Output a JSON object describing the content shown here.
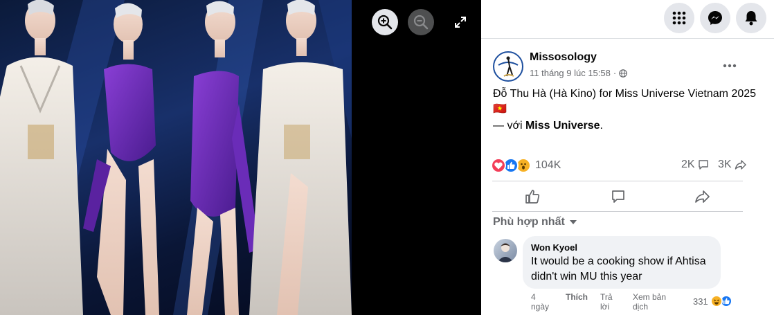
{
  "viewer": {
    "controls": [
      {
        "name": "zoom-in",
        "icon": "zoom-in-icon"
      },
      {
        "name": "zoom-out",
        "icon": "zoom-out-icon"
      },
      {
        "name": "fullscreen",
        "icon": "expand-icon"
      }
    ]
  },
  "topbar": {
    "buttons": [
      {
        "icon": "apps-grid-icon"
      },
      {
        "icon": "messenger-icon"
      },
      {
        "icon": "notifications-bell-icon"
      }
    ]
  },
  "post": {
    "author": "Missosology",
    "timestamp": "11 tháng 9 lúc 15:58",
    "separator": "·",
    "privacy_icon": "globe-icon",
    "text": "Đỗ Thu Hà (Hà Kino) for Miss Universe Vietnam 2025 🇻🇳",
    "with_prefix": "— với ",
    "with_name": "Miss Universe",
    "with_suffix": ".",
    "reactions": {
      "types": [
        "love",
        "like",
        "wow"
      ],
      "count": "104K"
    },
    "comments_count": "2K",
    "shares_count": "3K"
  },
  "actions": [
    {
      "name": "like",
      "icon": "thumbs-up-icon"
    },
    {
      "name": "comment",
      "icon": "comment-icon"
    },
    {
      "name": "share",
      "icon": "share-icon"
    }
  ],
  "comments": {
    "sort_label": "Phù hợp nhất",
    "items": [
      {
        "author": "Won Kyoel",
        "text": "It would be a cooking show if Ahtisa didn't win MU this year",
        "age_line1": "4",
        "age_line2": "ngày",
        "like_label": "Thích",
        "reply_line1": "Trả",
        "reply_line2": "lời",
        "translate_line1": "Xem bản",
        "translate_line2": "dịch",
        "reaction_count": "331"
      }
    ]
  },
  "colors": {
    "facebook_blue": "#1877f2",
    "love_red": "#f33e58",
    "wow_yellow": "#f7b125",
    "muted_text": "#65676b"
  }
}
